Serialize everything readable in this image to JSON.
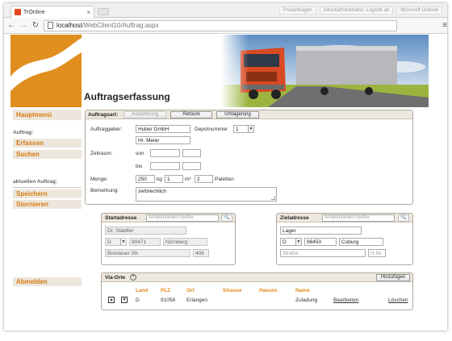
{
  "browser": {
    "tab_title": "TrOnline",
    "url_host": "localhost",
    "url_path": "/WebClient10/Auftrag.aspx",
    "top_right": [
      "Postanfragen",
      "Geschäftskontakte: Logistik ab",
      "Microsoft Outlook"
    ]
  },
  "page": {
    "title": "Auftragserfassung"
  },
  "sidebar": {
    "main_menu": "Hauptmenü",
    "section_auftrag": "Auftrag:",
    "item_erfassen": "Erfassen",
    "item_suchen": "Suchen",
    "section_aktuell": "aktuellen Auftrag:",
    "item_speichern": "Speichern",
    "item_stornieren": "Stornieren",
    "item_abmelden": "Abmelden"
  },
  "order": {
    "type_label": "Auftragsart:",
    "type_buttons": [
      "Auslieferung",
      "Retoure",
      "Umlagerung"
    ],
    "client_label": "Auftraggeber:",
    "client_value": "Huber GmbH",
    "client_contact": "Hr. Meier",
    "depot_label": "Depotnummer",
    "depot_value": "1",
    "period_label": "Zeitraum:",
    "from_label": "von",
    "to_label": "bis",
    "amount_label": "Menge:",
    "weight_value": "250",
    "weight_unit": "kg",
    "volume_value": "1",
    "volume_unit": "m³",
    "pallets_value": "2",
    "pallets_unit": "Paletten",
    "remark_label": "Bemerkung:",
    "remark_value": "zerbrechlich"
  },
  "start_address": {
    "title": "Startadresse",
    "search_placeholder": "Anfahrtstellen-Suche",
    "name": "Dr. Städtler",
    "country": "D",
    "zip": "90471",
    "city": "Nürnberg",
    "street": "Breslauer Str.",
    "house_no": "406"
  },
  "target_address": {
    "title": "Zieladresse",
    "search_placeholder": "Anfahrtstellen-Suche",
    "name": "Lager",
    "country": "D",
    "zip": "96450",
    "city": "Coburg",
    "street_placeholder": "Straße",
    "house_no_placeholder": "H.Nr."
  },
  "via": {
    "title": "Via-Orte",
    "add_button": "Hinzufügen",
    "columns": [
      "Land",
      "PLZ",
      "Ort",
      "Strasse",
      "Hausnr.",
      "Name"
    ],
    "rows": [
      {
        "land": "D",
        "plz": "91058",
        "ort": "Erlangen",
        "strasse": "",
        "hausnr": "",
        "name": "Zuladung",
        "edit": "Bearbeiten",
        "delete": "Löschen"
      }
    ]
  }
}
